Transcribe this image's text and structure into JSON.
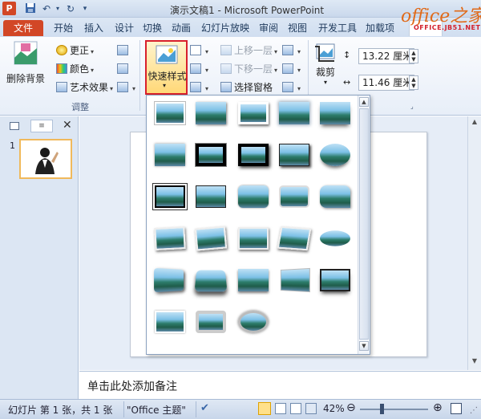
{
  "window": {
    "title": "演示文稿1 - Microsoft PowerPoint"
  },
  "watermark": {
    "brand": "office之家",
    "site": "OFFICE.JB51.NET"
  },
  "tabs": [
    {
      "label": "文件",
      "id": "file"
    },
    {
      "label": "开始",
      "id": "home"
    },
    {
      "label": "插入",
      "id": "insert"
    },
    {
      "label": "设计",
      "id": "design"
    },
    {
      "label": "切换",
      "id": "transitions"
    },
    {
      "label": "动画",
      "id": "animations"
    },
    {
      "label": "幻灯片放映",
      "id": "slideshow"
    },
    {
      "label": "审阅",
      "id": "review"
    },
    {
      "label": "视图",
      "id": "view"
    },
    {
      "label": "开发工具",
      "id": "developer"
    },
    {
      "label": "加载项",
      "id": "addins"
    }
  ],
  "ribbon": {
    "remove_background": "删除背景",
    "corrections": "更正",
    "color": "颜色",
    "artistic_effects": "艺术效果",
    "adjust_group": "调整",
    "quick_styles": "快速样式",
    "bring_forward": "上移一层",
    "send_backward": "下移一层",
    "selection_pane": "选择窗格",
    "crop": "裁剪",
    "height_value": "13.22 厘米",
    "width_value": "11.46 厘米"
  },
  "slides_pane": {
    "slide_number": "1"
  },
  "notes": {
    "placeholder": "单击此处添加备注"
  },
  "statusbar": {
    "slide_info": "幻灯片 第 1 张，共 1 张",
    "theme": "\"Office 主题\"",
    "zoom": "42%"
  }
}
